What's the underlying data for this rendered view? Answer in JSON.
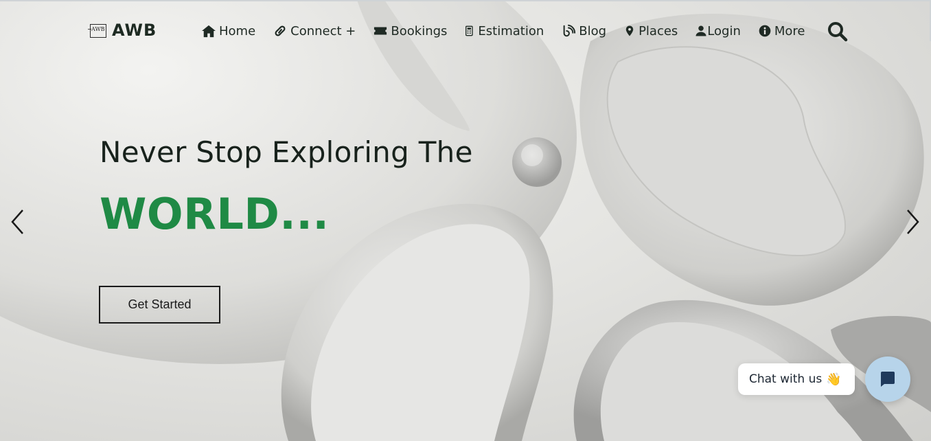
{
  "brand": {
    "logo_text": "AWB",
    "name": "AWB"
  },
  "nav": {
    "items": [
      {
        "label": "Home",
        "icon": "home-icon"
      },
      {
        "label": "Connect +",
        "icon": "link-icon"
      },
      {
        "label": "Bookings",
        "icon": "ticket-icon"
      },
      {
        "label": "Estimation",
        "icon": "calculator-icon"
      },
      {
        "label": "Blog",
        "icon": "blog-icon"
      },
      {
        "label": "Places",
        "icon": "map-pin-icon"
      },
      {
        "label": "Login",
        "icon": "user-icon"
      },
      {
        "label": "More",
        "icon": "info-icon"
      }
    ],
    "search_icon": "search-icon"
  },
  "hero": {
    "headline": "Never Stop Exploring The",
    "highlight": "WORLD...",
    "cta_label": "Get Started",
    "prev_icon": "chevron-left-icon",
    "next_icon": "chevron-right-icon"
  },
  "chat": {
    "pill_label": "Chat with us",
    "pill_emoji": "👋",
    "button_icon": "chat-bubble-icon"
  },
  "colors": {
    "accent_green": "#1f8a45",
    "text_dark": "#18221c",
    "chat_button": "#b7d4ea",
    "chat_icon": "#1f3a5c"
  }
}
